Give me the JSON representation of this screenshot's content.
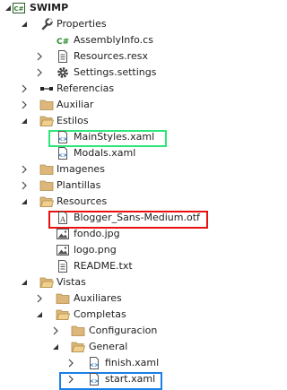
{
  "solution_explorer": {
    "project": {
      "label": "SWIMP",
      "badge": "C#"
    },
    "items": [
      {
        "id": "properties",
        "label": "Properties",
        "icon": "wrench-icon",
        "expander": "expanded"
      },
      {
        "id": "assemblyinfo",
        "label": "AssemblyInfo.cs",
        "icon": "csharp-file-icon",
        "expander": "none"
      },
      {
        "id": "resources-resx",
        "label": "Resources.resx",
        "icon": "resx-file-icon",
        "expander": "collapsed"
      },
      {
        "id": "settings",
        "label": "Settings.settings",
        "icon": "settings-gear-icon",
        "expander": "collapsed"
      },
      {
        "id": "referencias",
        "label": "Referencias",
        "icon": "references-icon",
        "expander": "collapsed"
      },
      {
        "id": "auxiliar",
        "label": "Auxiliar",
        "icon": "folder-icon",
        "expander": "collapsed"
      },
      {
        "id": "estilos",
        "label": "Estilos",
        "icon": "folder-open-icon",
        "expander": "expanded"
      },
      {
        "id": "mainstyles",
        "label": "MainStyles.xaml",
        "icon": "xaml-file-icon",
        "expander": "none"
      },
      {
        "id": "modals",
        "label": "Modals.xaml",
        "icon": "xaml-file-icon",
        "expander": "none"
      },
      {
        "id": "imagenes",
        "label": "Imagenes",
        "icon": "folder-icon",
        "expander": "collapsed"
      },
      {
        "id": "plantillas",
        "label": "Plantillas",
        "icon": "folder-icon",
        "expander": "collapsed"
      },
      {
        "id": "resources",
        "label": "Resources",
        "icon": "folder-open-icon",
        "expander": "expanded"
      },
      {
        "id": "blogger-font",
        "label": "Blogger_Sans-Medium.otf",
        "icon": "font-file-icon",
        "expander": "none"
      },
      {
        "id": "fondo",
        "label": "fondo.jpg",
        "icon": "image-file-icon",
        "expander": "none"
      },
      {
        "id": "logo",
        "label": "logo.png",
        "icon": "image-file-icon",
        "expander": "none"
      },
      {
        "id": "readme",
        "label": "README.txt",
        "icon": "text-file-icon",
        "expander": "none"
      },
      {
        "id": "vistas",
        "label": "Vistas",
        "icon": "folder-open-icon",
        "expander": "expanded"
      },
      {
        "id": "auxiliares",
        "label": "Auxiliares",
        "icon": "folder-icon",
        "expander": "collapsed"
      },
      {
        "id": "completas",
        "label": "Completas",
        "icon": "folder-open-icon",
        "expander": "expanded"
      },
      {
        "id": "configuracion",
        "label": "Configuracion",
        "icon": "folder-icon",
        "expander": "collapsed"
      },
      {
        "id": "general",
        "label": "General",
        "icon": "folder-open-icon",
        "expander": "expanded"
      },
      {
        "id": "finish",
        "label": "finish.xaml",
        "icon": "xaml-file-icon",
        "expander": "collapsed"
      },
      {
        "id": "start",
        "label": "start.xaml",
        "icon": "xaml-file-icon",
        "expander": "collapsed"
      }
    ]
  },
  "highlight_colors": {
    "mainstyles": "#2ee67a",
    "blogger-font": "#e81010",
    "start": "#1a7fe8"
  }
}
